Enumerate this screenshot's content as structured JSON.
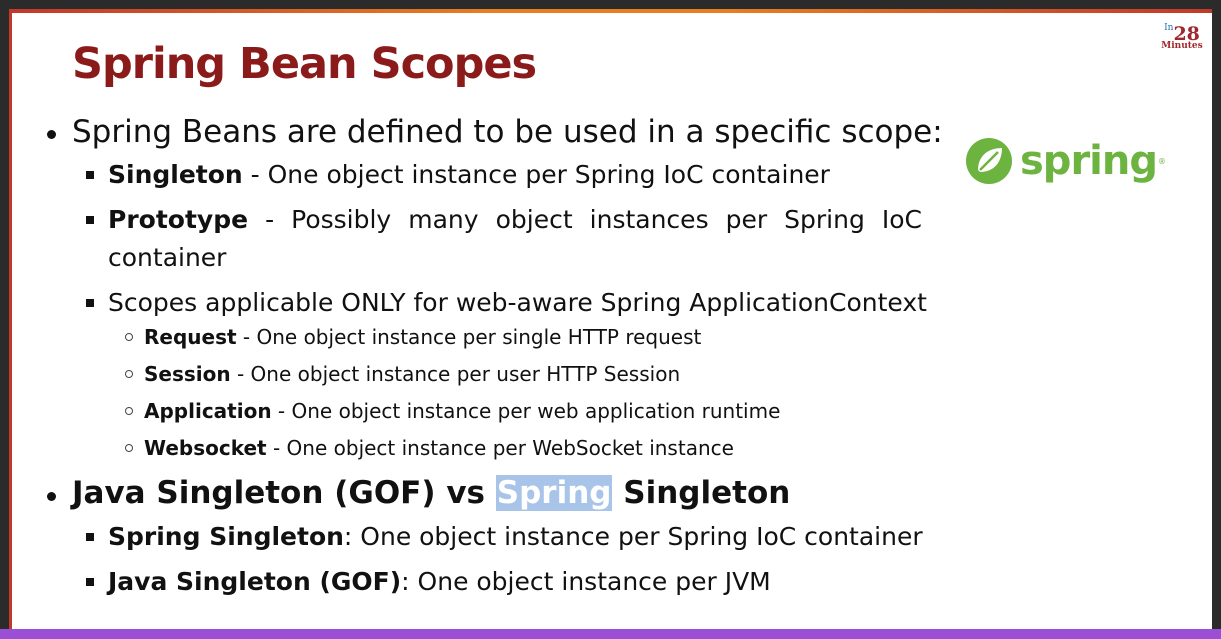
{
  "slide": {
    "title": "Spring Bean Scopes",
    "brand": {
      "in": "In",
      "number": "28",
      "minutes": "Minutes"
    },
    "spring_logo_text": "spring",
    "bullets": {
      "b1": "Spring Beans are defined to be used in a specific scope:",
      "singleton_bold": "Singleton",
      "singleton_text": " - One object instance per Spring IoC container",
      "prototype_bold": "Prototype",
      "prototype_text_line1": " - Possibly many object instances per Spring IoC",
      "prototype_text_line2": "container",
      "scopes_web": "Scopes applicable ONLY for web-aware Spring ApplicationContext",
      "request_bold": "Request",
      "request_text": " - One object instance per single HTTP request",
      "session_bold": "Session",
      "session_text": " - One object instance per user HTTP Session",
      "application_bold": "Application",
      "application_text": " - One object instance per web application runtime",
      "websocket_bold": "Websocket",
      "websocket_text": " - One object instance per WebSocket instance",
      "b2_part1": "Java Singleton (GOF) vs ",
      "b2_highlight": "Spring",
      "b2_part2": " Singleton",
      "spring_singleton_bold": "Spring Singleton",
      "spring_singleton_text": ": One object instance per Spring IoC container",
      "java_singleton_bold": "Java Singleton (GOF)",
      "java_singleton_text": ": One object instance per JVM"
    }
  },
  "colors": {
    "title": "#8b1a1a",
    "spring_green": "#6db33f",
    "highlight": "#a8c4e8",
    "bottom_bar": "#9b4fd6"
  }
}
